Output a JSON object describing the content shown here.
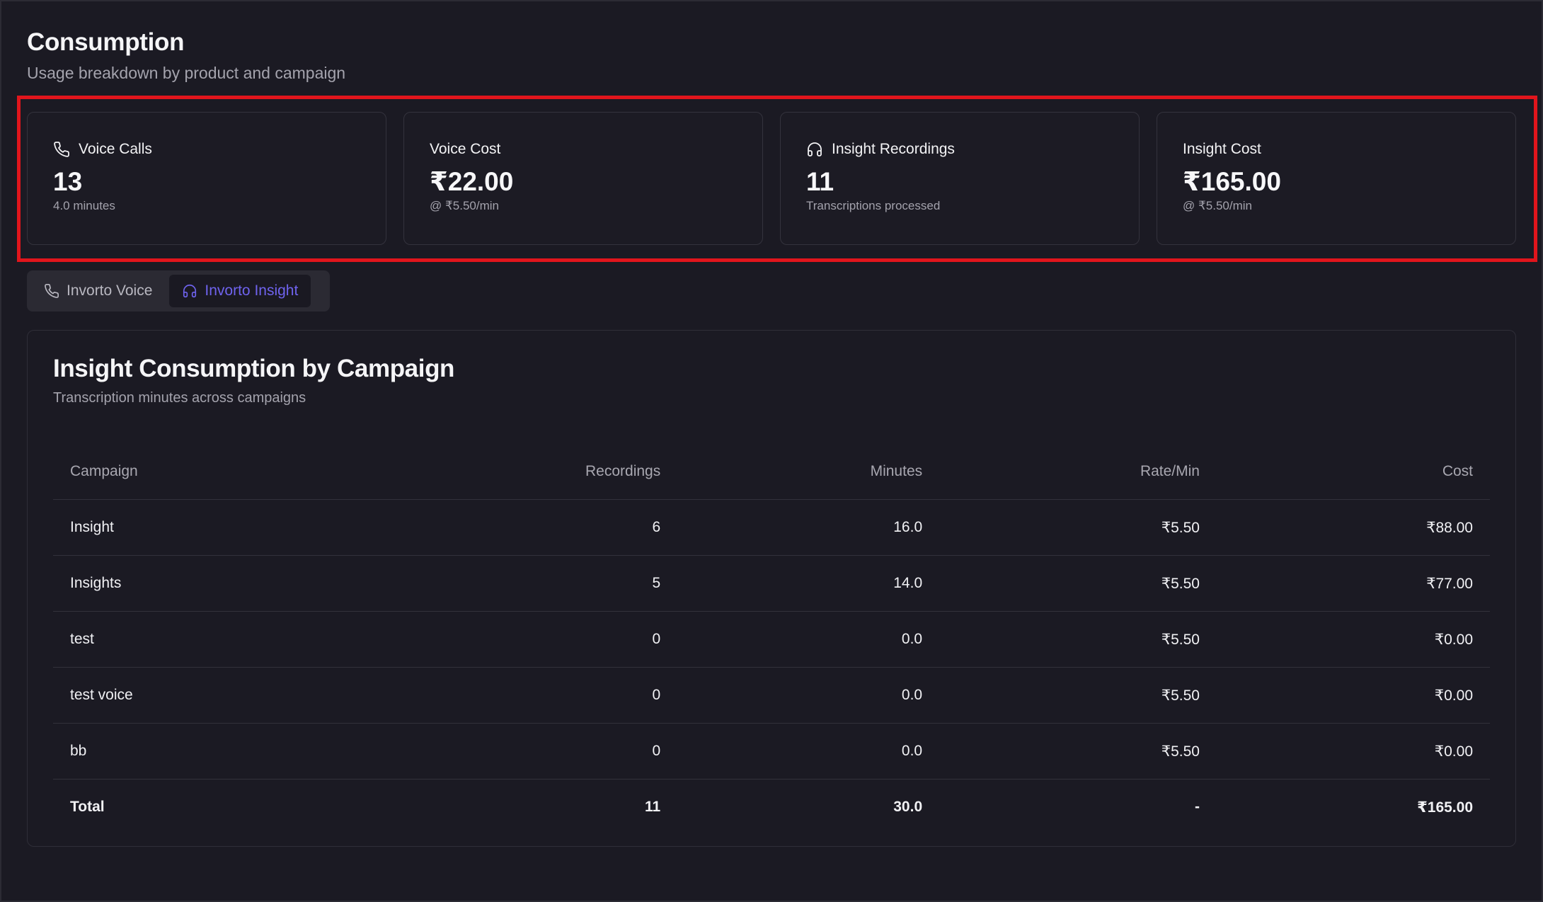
{
  "page": {
    "title": "Consumption",
    "subtitle": "Usage breakdown by product and campaign"
  },
  "cards": [
    {
      "label": "Voice Calls",
      "icon": "phone-icon",
      "value": "13",
      "sub": "4.0 minutes"
    },
    {
      "label": "Voice Cost",
      "value": "₹22.00",
      "sub": "@ ₹5.50/min"
    },
    {
      "label": "Insight Recordings",
      "icon": "headphones-icon",
      "value": "11",
      "sub": "Transcriptions processed"
    },
    {
      "label": "Insight Cost",
      "value": "₹165.00",
      "sub": "@ ₹5.50/min"
    }
  ],
  "tabs": [
    {
      "label": "Invorto Voice",
      "icon": "phone-icon",
      "active": false
    },
    {
      "label": "Invorto Insight",
      "icon": "headphones-icon",
      "active": true
    }
  ],
  "colors": {
    "background": "#1b1a23",
    "accent": "#6f63ee",
    "highlight_border": "#e1151c"
  },
  "panel": {
    "title": "Insight Consumption by Campaign",
    "subtitle": "Transcription minutes across campaigns"
  },
  "table": {
    "headers": [
      "Campaign",
      "Recordings",
      "Minutes",
      "Rate/Min",
      "Cost"
    ],
    "rows": [
      [
        "Insight",
        "6",
        "16.0",
        "₹5.50",
        "₹88.00"
      ],
      [
        "Insights",
        "5",
        "14.0",
        "₹5.50",
        "₹77.00"
      ],
      [
        "test",
        "0",
        "0.0",
        "₹5.50",
        "₹0.00"
      ],
      [
        "test voice",
        "0",
        "0.0",
        "₹5.50",
        "₹0.00"
      ],
      [
        "bb",
        "0",
        "0.0",
        "₹5.50",
        "₹0.00"
      ]
    ],
    "total": [
      "Total",
      "11",
      "30.0",
      "-",
      "₹165.00"
    ]
  }
}
